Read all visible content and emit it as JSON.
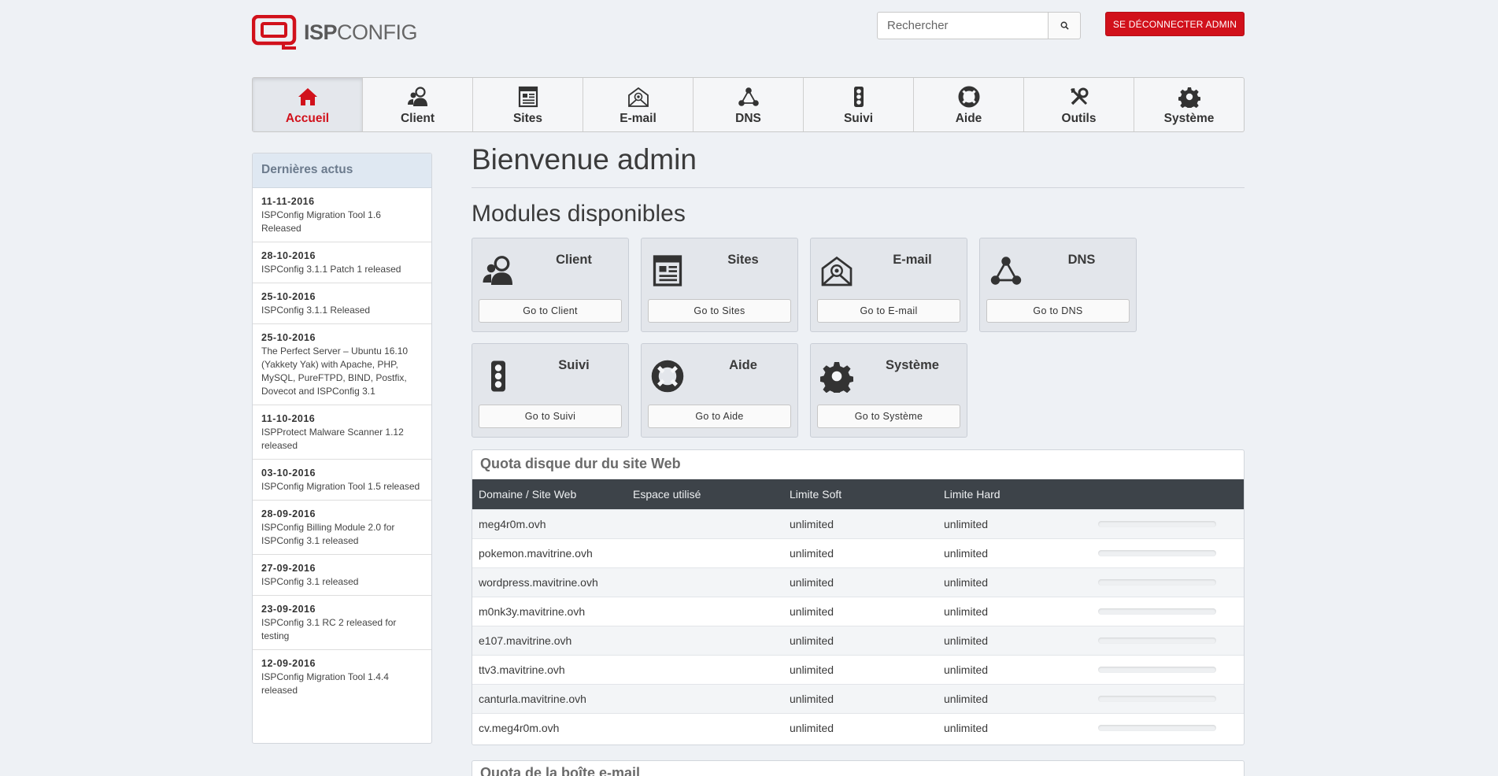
{
  "brand": {
    "name_bold": "ISP",
    "name_light": "CONFIG"
  },
  "search": {
    "placeholder": "Rechercher"
  },
  "logout_label": "SE DÉCONNECTER ADMIN",
  "colors": {
    "accent": "#d1111b",
    "table_header": "#3d4349",
    "sidebar_head": "#dfe8f2"
  },
  "nav": [
    {
      "label": "Accueil",
      "icon": "home-icon",
      "active": true
    },
    {
      "label": "Client",
      "icon": "users-icon"
    },
    {
      "label": "Sites",
      "icon": "sites-icon"
    },
    {
      "label": "E-mail",
      "icon": "email-icon"
    },
    {
      "label": "DNS",
      "icon": "dns-icon"
    },
    {
      "label": "Suivi",
      "icon": "monitor-icon"
    },
    {
      "label": "Aide",
      "icon": "help-icon"
    },
    {
      "label": "Outils",
      "icon": "tools-icon"
    },
    {
      "label": "Système",
      "icon": "gear-icon"
    }
  ],
  "sidebar": {
    "title": "Dernières actus",
    "news": [
      {
        "date": "11-11-2016",
        "title": "ISPConfig Migration Tool 1.6 Released"
      },
      {
        "date": "28-10-2016",
        "title": "ISPConfig 3.1.1 Patch 1 released"
      },
      {
        "date": "25-10-2016",
        "title": "ISPConfig 3.1.1 Released"
      },
      {
        "date": "25-10-2016",
        "title": "The Perfect Server – Ubuntu 16.10 (Yakkety Yak) with Apache, PHP, MySQL, PureFTPD, BIND, Postfix, Dovecot and ISPConfig 3.1"
      },
      {
        "date": "11-10-2016",
        "title": "ISPProtect Malware Scanner 1.12 released"
      },
      {
        "date": "03-10-2016",
        "title": "ISPConfig Migration Tool 1.5 released"
      },
      {
        "date": "28-09-2016",
        "title": "ISPConfig Billing Module 2.0 for ISPConfig 3.1 released"
      },
      {
        "date": "27-09-2016",
        "title": "ISPConfig 3.1 released"
      },
      {
        "date": "23-09-2016",
        "title": "ISPConfig 3.1 RC 2 released for testing"
      },
      {
        "date": "12-09-2016",
        "title": "ISPConfig Migration Tool 1.4.4 released"
      }
    ]
  },
  "main": {
    "title": "Bienvenue admin",
    "modules_title": "Modules disponibles",
    "modules": [
      {
        "title": "Client",
        "button": "Go to Client",
        "icon": "users-icon"
      },
      {
        "title": "Sites",
        "button": "Go to Sites",
        "icon": "sites-icon"
      },
      {
        "title": "E-mail",
        "button": "Go to E-mail",
        "icon": "email-icon"
      },
      {
        "title": "DNS",
        "button": "Go to DNS",
        "icon": "dns-icon"
      },
      {
        "title": "Suivi",
        "button": "Go to Suivi",
        "icon": "monitor-icon"
      },
      {
        "title": "Aide",
        "button": "Go to Aide",
        "icon": "help-icon"
      },
      {
        "title": "Système",
        "button": "Go to Système",
        "icon": "gear-icon"
      }
    ],
    "quota": {
      "title": "Quota disque dur du site Web",
      "headers": [
        "Domaine / Site Web",
        "Espace utilisé",
        "Limite Soft",
        "Limite Hard",
        ""
      ],
      "rows": [
        {
          "domain": "meg4r0m.ovh",
          "used": "",
          "soft": "unlimited",
          "hard": "unlimited",
          "usage": 0
        },
        {
          "domain": "pokemon.mavitrine.ovh",
          "used": "",
          "soft": "unlimited",
          "hard": "unlimited",
          "usage": 0
        },
        {
          "domain": "wordpress.mavitrine.ovh",
          "used": "",
          "soft": "unlimited",
          "hard": "unlimited",
          "usage": 0
        },
        {
          "domain": "m0nk3y.mavitrine.ovh",
          "used": "",
          "soft": "unlimited",
          "hard": "unlimited",
          "usage": 0
        },
        {
          "domain": "e107.mavitrine.ovh",
          "used": "",
          "soft": "unlimited",
          "hard": "unlimited",
          "usage": 0
        },
        {
          "domain": "ttv3.mavitrine.ovh",
          "used": "",
          "soft": "unlimited",
          "hard": "unlimited",
          "usage": 0
        },
        {
          "domain": "canturla.mavitrine.ovh",
          "used": "",
          "soft": "unlimited",
          "hard": "unlimited",
          "usage": 0
        },
        {
          "domain": "cv.meg4r0m.ovh",
          "used": "",
          "soft": "unlimited",
          "hard": "unlimited",
          "usage": 0
        }
      ]
    },
    "mail_quota_title": "Quota de la boîte e-mail"
  }
}
